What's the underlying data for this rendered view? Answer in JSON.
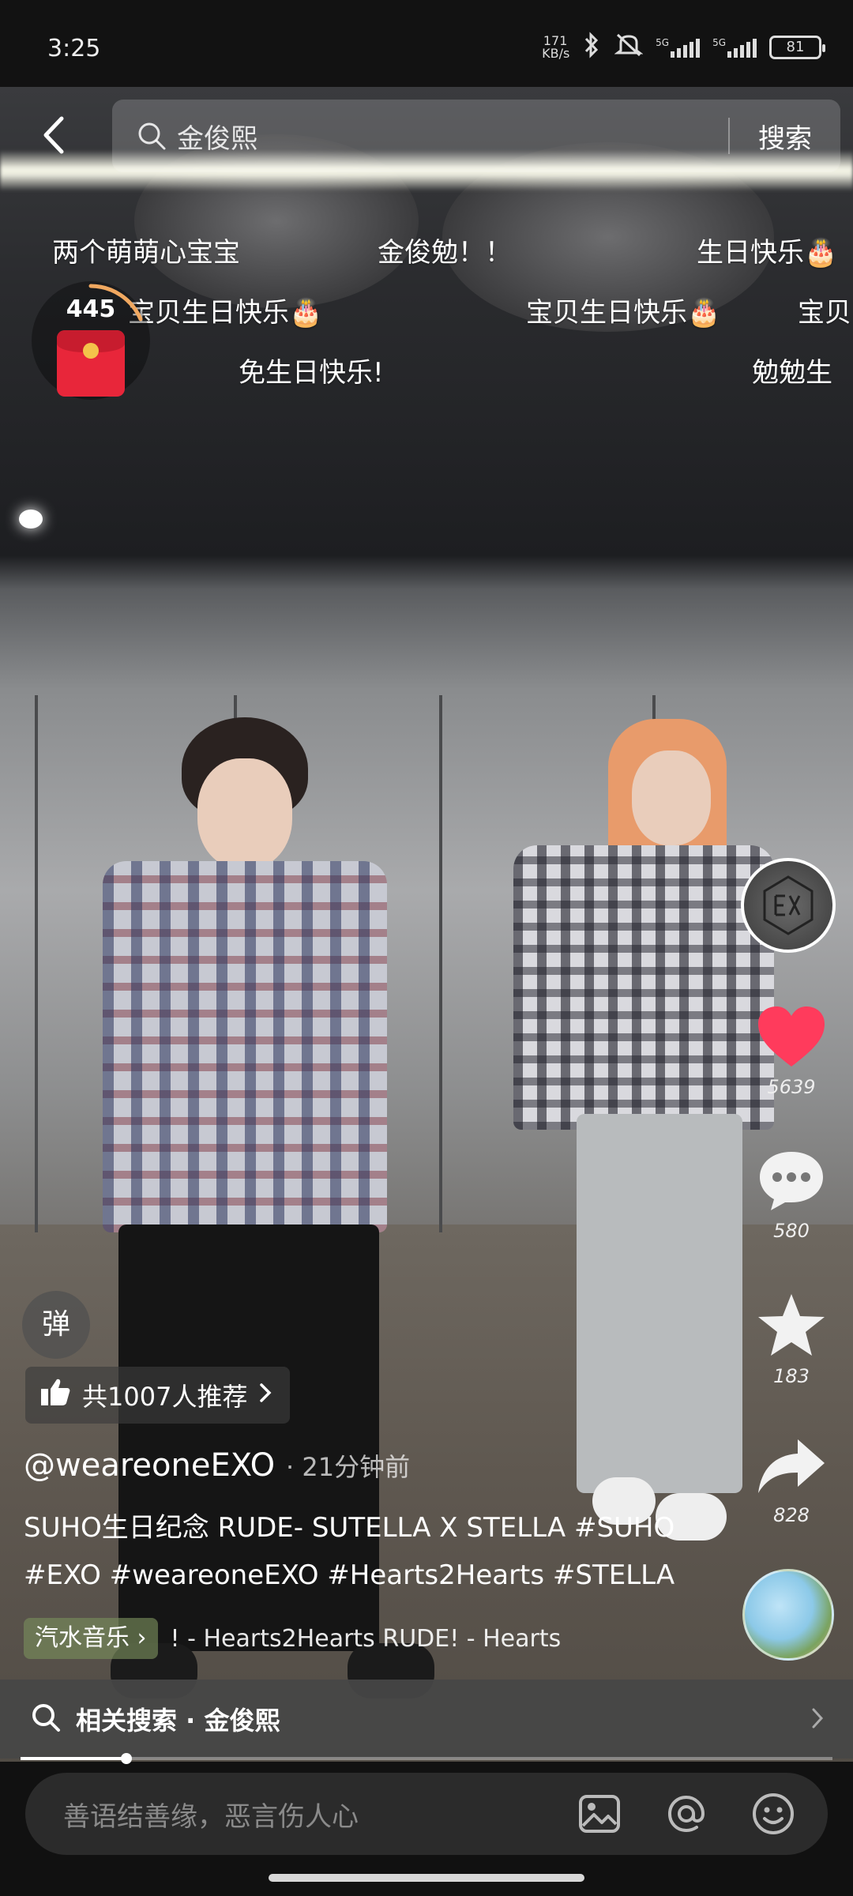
{
  "status_bar": {
    "time": "3:25",
    "network_speed": "171 KB/s",
    "sig1_label": "5G",
    "sig2_label": "5G",
    "battery": "81"
  },
  "search": {
    "query": "金俊熙",
    "button": "搜索"
  },
  "red_packet": {
    "count": "445"
  },
  "danmaku": [
    "两个萌萌心宝宝",
    "金俊勉！！",
    "生日快乐🎂",
    "宝贝生日快乐🎂",
    "宝贝生日快乐🎂",
    "宝贝",
    "免生日快乐!",
    "勉勉生"
  ],
  "actions": {
    "likes": "5639",
    "comments": "580",
    "favorites": "183",
    "shares": "828"
  },
  "video_info": {
    "danmaku_toggle": "弹",
    "recommend": "共1007人推荐",
    "author": "@weareoneEXO",
    "time_ago": "· 21分钟前",
    "description_line1": "SUHO生日纪念 RUDE- SUTELLA X STELLA #SUHO",
    "description_line2": "#EXO #weareoneEXO #Hearts2Hearts #STELLA",
    "music_tag": "汽水音乐",
    "music_name": "! - Hearts2Hearts     RUDE! - Hearts"
  },
  "related_search": {
    "label": "相关搜索 · 金俊熙"
  },
  "progress": {
    "fraction": 0.13
  },
  "comment": {
    "placeholder": "善语结善缘，恶言伤人心"
  },
  "colors": {
    "like_red": "#ff3b5c",
    "red_packet": "#e8263a"
  }
}
